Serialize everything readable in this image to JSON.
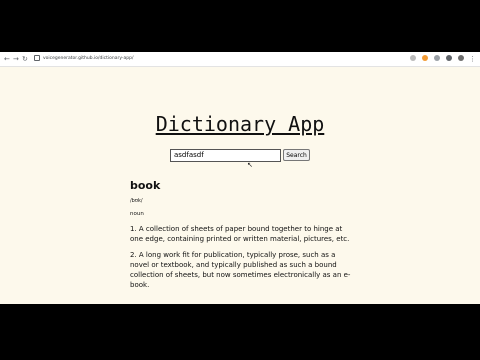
{
  "browser": {
    "url": "voicegenerator.github.io/dictionary-app/"
  },
  "app": {
    "title": "Dictionary App"
  },
  "search": {
    "value": "asdfasdf",
    "button_label": "Search"
  },
  "result": {
    "word": "book",
    "phonetic": "/bʊk/",
    "part_of_speech": "noun",
    "definitions": [
      "1. A collection of sheets of paper bound together to hinge at one edge, containing printed or written material, pictures, etc.",
      "2. A long work fit for publication, typically prose, such as a novel or textbook, and typically published as such a bound collection of sheets, but now sometimes electronically as an e-book."
    ]
  }
}
